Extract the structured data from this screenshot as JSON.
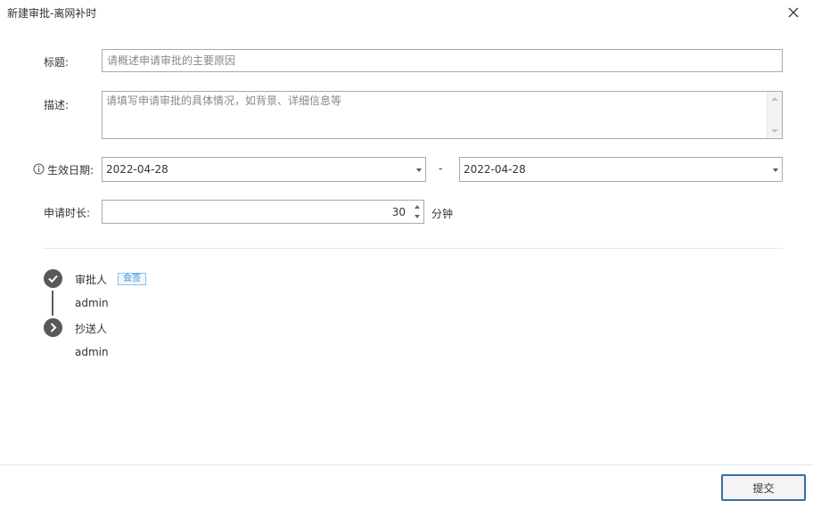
{
  "dialog": {
    "title": "新建审批-离网补时",
    "submit_label": "提交"
  },
  "form": {
    "title_label": "标题:",
    "title_placeholder": "请概述申请审批的主要原因",
    "description_label": "描述:",
    "description_placeholder": "请填写申请审批的具体情况，如背景、详细信息等",
    "effective_date_label": "生效日期:",
    "start_date": "2022-04-28",
    "date_separator": "-",
    "end_date": "2022-04-28",
    "duration_label": "申请时长:",
    "duration_value": "30",
    "duration_unit": "分钟"
  },
  "workflow": {
    "steps": [
      {
        "label": "审批人",
        "tag": "会签",
        "user": "admin",
        "icon": "check-circle-icon"
      },
      {
        "label": "抄送人",
        "user": "admin",
        "icon": "chevron-right-circle-icon"
      }
    ]
  },
  "colors": {
    "step_icon": "#595959",
    "tag_border": "#8fc3ea",
    "tag_text": "#3a8fd6",
    "button_border": "#3b6e9e"
  }
}
